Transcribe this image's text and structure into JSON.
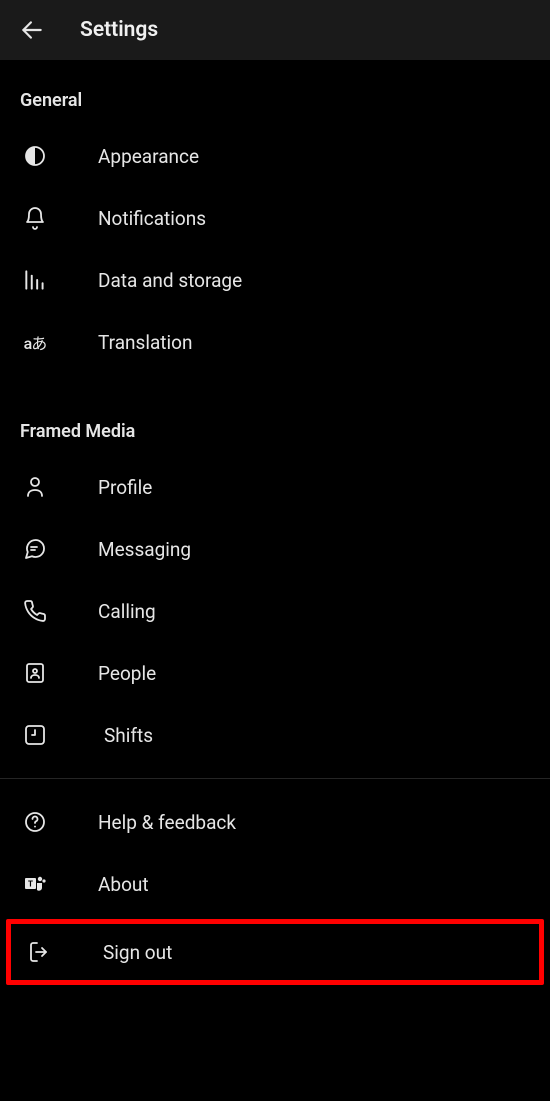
{
  "header": {
    "title": "Settings"
  },
  "sections": {
    "general": {
      "heading": "General",
      "appearance": "Appearance",
      "notifications": "Notifications",
      "data_storage": "Data and storage",
      "translation": "Translation"
    },
    "org": {
      "heading": "Framed Media",
      "profile": "Profile",
      "messaging": "Messaging",
      "calling": "Calling",
      "people": "People",
      "shifts": "Shifts"
    },
    "footer": {
      "help": "Help & feedback",
      "about": "About",
      "signout": "Sign out"
    }
  }
}
